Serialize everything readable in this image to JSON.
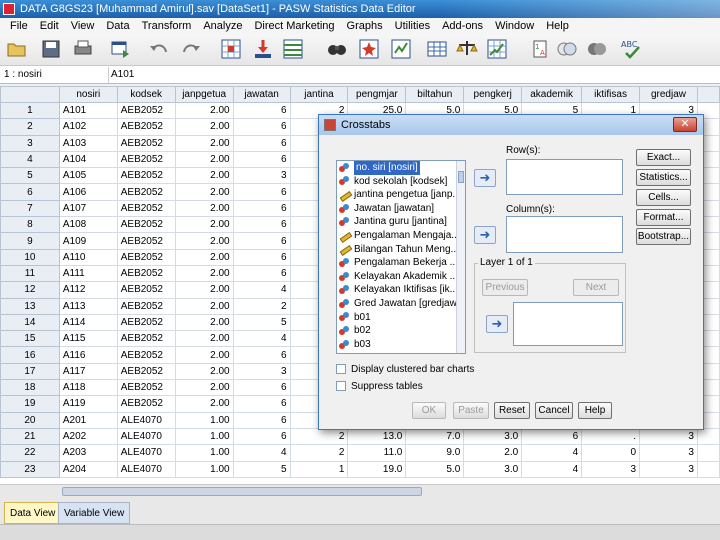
{
  "window": {
    "title": "DATA G8GS23 [Muhammad Amirul].sav [DataSet1] - PASW Statistics Data Editor"
  },
  "menu": [
    "File",
    "Edit",
    "View",
    "Data",
    "Transform",
    "Analyze",
    "Direct Marketing",
    "Graphs",
    "Utilities",
    "Add-ons",
    "Window",
    "Help"
  ],
  "toolbar_icons": [
    "open-folder-icon",
    "save-icon",
    "print-icon",
    "dialog-recall-icon",
    "undo-icon",
    "redo-icon",
    "goto-case-icon",
    "goto-variable-icon",
    "variables-icon",
    "find-icon",
    "insert-cases-icon",
    "insert-variable-icon",
    "split-file-icon",
    "weight-cases-icon",
    "select-cases-icon",
    "value-labels-icon",
    "use-sets-icon",
    "show-all-variables-icon",
    "spelling-icon"
  ],
  "refbar": {
    "cell_ref": "1 : nosiri",
    "cell_value": "A101"
  },
  "grid": {
    "columns": [
      "nosiri",
      "kodsek",
      "janpgetua",
      "jawatan",
      "jantina",
      "pengmjar",
      "biltahun",
      "pengkerj",
      "akademik",
      "iktifisas",
      "gredjaw"
    ],
    "rows": [
      [
        "A101",
        "AEB2052",
        "2.00",
        "6",
        "2",
        "25.0",
        "5.0",
        "5.0",
        "5",
        "1",
        "3"
      ],
      [
        "A102",
        "AEB2052",
        "2.00",
        "6",
        "",
        "",
        "",
        "",
        "",
        "",
        ""
      ],
      [
        "A103",
        "AEB2052",
        "2.00",
        "6",
        "",
        "",
        "",
        "",
        "",
        "",
        ""
      ],
      [
        "A104",
        "AEB2052",
        "2.00",
        "6",
        "",
        "",
        "",
        "",
        "",
        "",
        ""
      ],
      [
        "A105",
        "AEB2052",
        "2.00",
        "3",
        "",
        "",
        "",
        "",
        "",
        "",
        ""
      ],
      [
        "A106",
        "AEB2052",
        "2.00",
        "6",
        "",
        "",
        "",
        "",
        "",
        "",
        ""
      ],
      [
        "A107",
        "AEB2052",
        "2.00",
        "6",
        "",
        "",
        "",
        "",
        "",
        "",
        ""
      ],
      [
        "A108",
        "AEB2052",
        "2.00",
        "6",
        "",
        "",
        "",
        "",
        "",
        "",
        ""
      ],
      [
        "A109",
        "AEB2052",
        "2.00",
        "6",
        "",
        "",
        "",
        "",
        "",
        "",
        ""
      ],
      [
        "A110",
        "AEB2052",
        "2.00",
        "6",
        "",
        "",
        "",
        "",
        "",
        "",
        ""
      ],
      [
        "A111",
        "AEB2052",
        "2.00",
        "6",
        "",
        "",
        "",
        "",
        "",
        "",
        ""
      ],
      [
        "A112",
        "AEB2052",
        "2.00",
        "4",
        "",
        "",
        "",
        "",
        "",
        "",
        ""
      ],
      [
        "A113",
        "AEB2052",
        "2.00",
        "2",
        "",
        "",
        "",
        "",
        "",
        "",
        ""
      ],
      [
        "A114",
        "AEB2052",
        "2.00",
        "5",
        "",
        "",
        "",
        "",
        "",
        "",
        ""
      ],
      [
        "A115",
        "AEB2052",
        "2.00",
        "4",
        "",
        "",
        "",
        "",
        "",
        "",
        ""
      ],
      [
        "A116",
        "AEB2052",
        "2.00",
        "6",
        "",
        "",
        "",
        "",
        "",
        "",
        ""
      ],
      [
        "A117",
        "AEB2052",
        "2.00",
        "3",
        "",
        "",
        "",
        "",
        "",
        "",
        ""
      ],
      [
        "A118",
        "AEB2052",
        "2.00",
        "6",
        "",
        "",
        "",
        "",
        "",
        "",
        ""
      ],
      [
        "A119",
        "AEB2052",
        "2.00",
        "6",
        "",
        "",
        "",
        "",
        "",
        "",
        ""
      ],
      [
        "A201",
        "ALE4070",
        "1.00",
        "6",
        "",
        "",
        "",
        "",
        "",
        "",
        ""
      ],
      [
        "A202",
        "ALE4070",
        "1.00",
        "6",
        "2",
        "13.0",
        "7.0",
        "3.0",
        "6",
        ".",
        "3"
      ],
      [
        "A203",
        "ALE4070",
        "1.00",
        "4",
        "2",
        "11.0",
        "9.0",
        "2.0",
        "4",
        "0",
        "3"
      ],
      [
        "A204",
        "ALE4070",
        "1.00",
        "5",
        "1",
        "19.0",
        "5.0",
        "3.0",
        "4",
        "3",
        "3"
      ]
    ]
  },
  "tabs": {
    "data_view": "Data View",
    "variable_view": "Variable View"
  },
  "crosstabs": {
    "title": "Crosstabs",
    "variables": [
      {
        "label": "no. siri [nosiri]",
        "icon": "nominal-icon"
      },
      {
        "label": "kod sekolah [kodsek]",
        "icon": "nominal-icon"
      },
      {
        "label": "jantina pengetua [janp...",
        "icon": "scale-icon"
      },
      {
        "label": "Jawatan [jawatan]",
        "icon": "nominal-icon"
      },
      {
        "label": "Jantina guru [jantina]",
        "icon": "nominal-icon"
      },
      {
        "label": "Pengalaman Mengaja...",
        "icon": "scale-icon"
      },
      {
        "label": "Bilangan Tahun Meng...",
        "icon": "scale-icon"
      },
      {
        "label": "Pengalaman Bekerja ...",
        "icon": "nominal-icon"
      },
      {
        "label": "Kelayakan Akademik ...",
        "icon": "nominal-icon"
      },
      {
        "label": "Kelayakan Iktifisas [ik...",
        "icon": "nominal-icon"
      },
      {
        "label": "Gred Jawatan [gredjaw]",
        "icon": "nominal-icon"
      },
      {
        "label": "b01",
        "icon": "nominal-icon"
      },
      {
        "label": "b02",
        "icon": "nominal-icon"
      },
      {
        "label": "b03",
        "icon": "nominal-icon"
      }
    ],
    "rows_label": "Row(s):",
    "columns_label": "Column(s):",
    "layer_label": "Layer 1 of 1",
    "previous_label": "Previous",
    "next_label": "Next",
    "side_buttons": [
      "Exact...",
      "Statistics...",
      "Cells...",
      "Format...",
      "Bootstrap..."
    ],
    "display_clustered_label": "Display clustered bar charts",
    "suppress_tables_label": "Suppress tables",
    "bottom_buttons": {
      "ok": "OK",
      "paste": "Paste",
      "reset": "Reset",
      "cancel": "Cancel",
      "help": "Help"
    }
  }
}
